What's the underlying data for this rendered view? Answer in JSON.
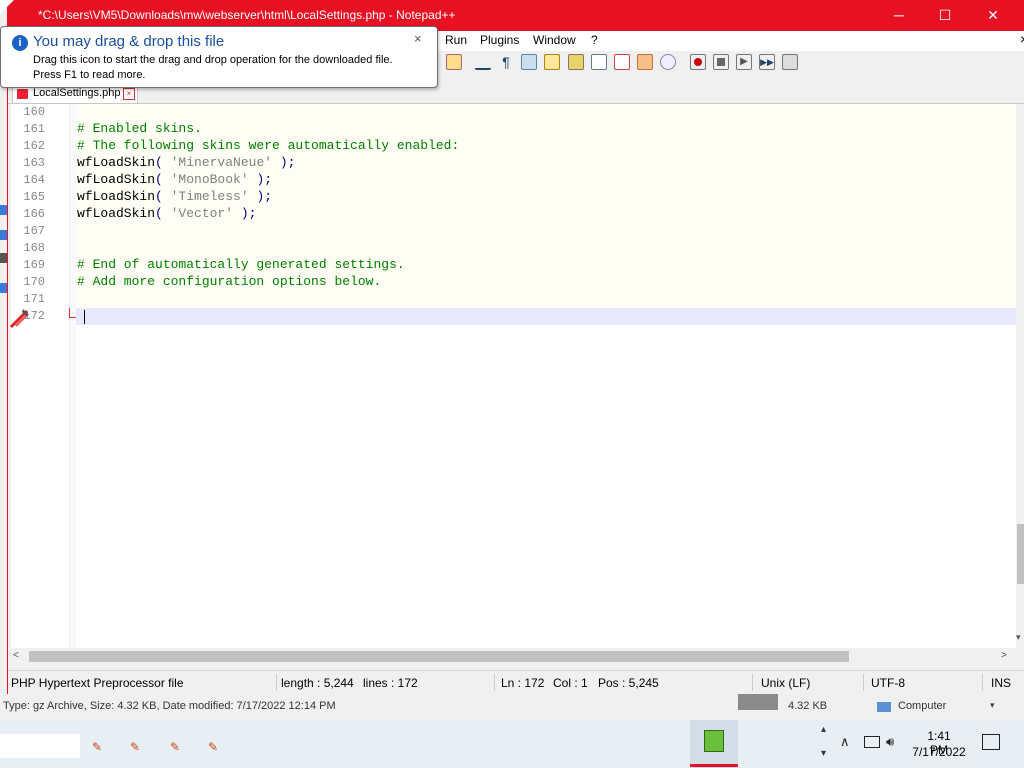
{
  "window": {
    "title": "*C:\\Users\\VM5\\Downloads\\mw\\webserver\\html\\LocalSettings.php - Notepad++",
    "accent_color": "#e81123",
    "controls": {
      "minimize": "─",
      "maximize": "☐",
      "close": "✕"
    }
  },
  "menu": [
    {
      "label": "Run"
    },
    {
      "label": "Plugins"
    },
    {
      "label": "Window"
    },
    {
      "label": "?"
    }
  ],
  "menu_close": "×",
  "tab": {
    "label": "LocalSettings.php"
  },
  "editor": {
    "lines": [
      {
        "num": "160",
        "parts": []
      },
      {
        "num": "161",
        "parts": [
          {
            "cls": "comment",
            "text": "# Enabled skins."
          }
        ]
      },
      {
        "num": "162",
        "parts": [
          {
            "cls": "comment",
            "text": "# The following skins were automatically enabled:"
          }
        ]
      },
      {
        "num": "163",
        "parts": [
          {
            "cls": "",
            "text": "wfLoadSkin"
          },
          {
            "cls": "op",
            "text": "( "
          },
          {
            "cls": "str",
            "text": "'MinervaNeue'"
          },
          {
            "cls": "op",
            "text": " );"
          }
        ]
      },
      {
        "num": "164",
        "parts": [
          {
            "cls": "",
            "text": "wfLoadSkin"
          },
          {
            "cls": "op",
            "text": "( "
          },
          {
            "cls": "str",
            "text": "'MonoBook'"
          },
          {
            "cls": "op",
            "text": " );"
          }
        ]
      },
      {
        "num": "165",
        "parts": [
          {
            "cls": "",
            "text": "wfLoadSkin"
          },
          {
            "cls": "op",
            "text": "( "
          },
          {
            "cls": "str",
            "text": "'Timeless'"
          },
          {
            "cls": "op",
            "text": " );"
          }
        ]
      },
      {
        "num": "166",
        "parts": [
          {
            "cls": "",
            "text": "wfLoadSkin"
          },
          {
            "cls": "op",
            "text": "( "
          },
          {
            "cls": "str",
            "text": "'Vector'"
          },
          {
            "cls": "op",
            "text": " );"
          }
        ]
      },
      {
        "num": "167",
        "parts": []
      },
      {
        "num": "168",
        "parts": []
      },
      {
        "num": "169",
        "parts": [
          {
            "cls": "comment",
            "text": "# End of automatically generated settings."
          }
        ]
      },
      {
        "num": "170",
        "parts": [
          {
            "cls": "comment",
            "text": "# Add more configuration options below."
          }
        ]
      },
      {
        "num": "171",
        "parts": []
      },
      {
        "num": "172",
        "parts": []
      }
    ]
  },
  "statusbar": {
    "file_type": "PHP Hypertext Preprocessor file",
    "length": "length : 5,244",
    "lines": "lines : 172",
    "ln": "Ln : 172",
    "col": "Col : 1",
    "pos": "Pos : 5,245",
    "eol": "Unix (LF)",
    "encoding": "UTF-8",
    "mode": "INS"
  },
  "balloon": {
    "icon": "i",
    "title": "You may drag & drop this file",
    "body_line1": "Drag this icon to start the drag and drop operation for the downloaded file.",
    "body_line2": "Press F1 to read more.",
    "close": "×"
  },
  "explorer": {
    "status": "Type: gz Archive, Size: 4.32 KB, Date modified: 7/17/2022 12:14 PM",
    "size": "4.32 KB",
    "location": "Computer"
  },
  "taskbar": {
    "time": "1:41 PM",
    "date": "7/17/2022"
  },
  "scroll": {
    "up": "▴",
    "down": "▾",
    "left": "<",
    "right": ">"
  }
}
